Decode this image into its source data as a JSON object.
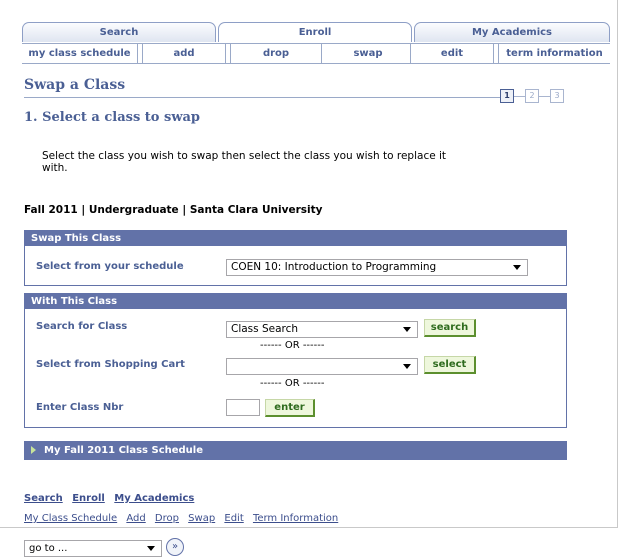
{
  "tabs": [
    {
      "label": "Search"
    },
    {
      "label": "Enroll"
    },
    {
      "label": "My Academics"
    }
  ],
  "subtabs": [
    {
      "label": "my class schedule"
    },
    {
      "label": "add"
    },
    {
      "label": "drop"
    },
    {
      "label": "swap"
    },
    {
      "label": "edit"
    },
    {
      "label": "term information"
    }
  ],
  "page_title": "Swap a Class",
  "steps": [
    "1",
    "2",
    "3"
  ],
  "step_heading": "1.  Select a class to swap",
  "instructions": "Select the class you wish to swap then select the class you wish to replace it with.",
  "term_line": "Fall 2011 | Undergraduate | Santa Clara University",
  "swap_this": {
    "header": "Swap This Class",
    "select_label": "Select from your schedule",
    "select_value": "COEN 10: Introduction to Programming"
  },
  "with_this": {
    "header": "With This Class",
    "search_label": "Search for Class",
    "search_value": "Class Search",
    "search_button": "search",
    "or_text_1": "------ OR ------",
    "cart_label": "Select from Shopping Cart",
    "cart_value": "",
    "select_button": "select",
    "or_text_2": "------ OR ------",
    "nbr_label": "Enter Class Nbr",
    "nbr_value": "",
    "enter_button": "enter"
  },
  "schedule_bar": "My Fall 2011 Class Schedule",
  "bottom_nav_main": [
    "Search",
    "Enroll",
    "My Academics"
  ],
  "bottom_nav_sub": [
    "My Class Schedule",
    "Add",
    "Drop",
    "Swap",
    "Edit",
    "Term Information"
  ],
  "goto": {
    "value": "go to ...",
    "button": "»"
  },
  "colors": {
    "accent": "#4a5f94",
    "header_bar": "#6272a8",
    "button_green": "#2e6b1e"
  }
}
